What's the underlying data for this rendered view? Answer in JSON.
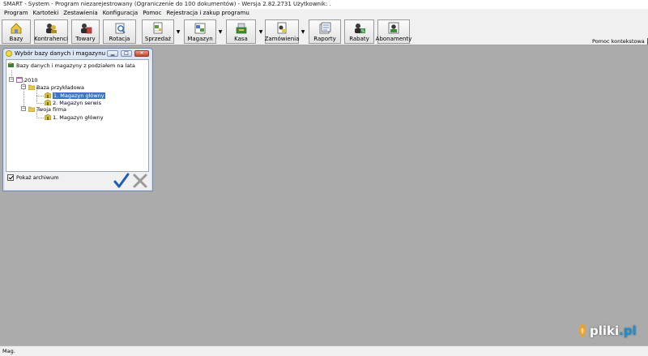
{
  "window_title": "SMART - System - Program niezarejestrowany (Ograniczenie do 100 dokumentów) - Wersja 2.82.2731     Użytkownik: .",
  "menu": [
    "Program",
    "Kartoteki",
    "Zestawienia",
    "Konfiguracja",
    "Pomoc",
    "Rejestracja i zakup programu"
  ],
  "toolbar": {
    "bazy": "Bazy",
    "kontrahenci": "Kontrahenci",
    "towary": "Towary",
    "rotacja": "Rotacja",
    "sprzedaz": "Sprzedaż",
    "magazyn": "Magazyn",
    "kasa": "Kasa",
    "zamowienia": "Zamówienia",
    "raporty": "Raporty",
    "rabaty": "Rabaty",
    "abonamenty": "Abonamenty",
    "dropdown_glyph": "▼"
  },
  "help_checkbox": {
    "label": "Pomoc kontekstowa",
    "checked": true
  },
  "dialog": {
    "title": "Wybór bazy danych i magazynu",
    "controls": {
      "minimize": "▁",
      "maximize": "□",
      "close": "✕"
    },
    "tree": {
      "root": "Bazy danych i magazyny z podziałem na lata",
      "year": "2010",
      "db1": "Baza przykładowa",
      "db1_mag1": "1. Magazyn główny",
      "db1_mag2": "2. Magazyn serwis",
      "db2": "Twoja firma",
      "db2_mag1": "1. Magazyn główny",
      "expander": "−"
    },
    "show_archive": {
      "label": "Pokaż archiwum",
      "checked": true
    }
  },
  "status": {
    "text": "Mag."
  },
  "watermark": {
    "name": "pliki",
    "tld": ".pl"
  },
  "colors": {
    "desktop": "#ababab",
    "selection": "#3d74c7",
    "ok_check": "#1f5fb3",
    "watermark_accent": "#1a8fd6"
  },
  "icons": [
    "database-icon",
    "contractors-icon",
    "goods-icon",
    "rotation-icon",
    "sales-icon",
    "warehouse-icon",
    "cash-register-icon",
    "orders-icon",
    "reports-icon",
    "discounts-icon",
    "subscriptions-icon"
  ]
}
